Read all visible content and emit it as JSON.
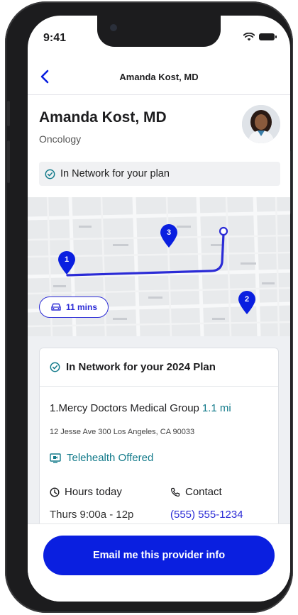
{
  "status_bar": {
    "time": "9:41"
  },
  "nav": {
    "title": "Amanda Kost, MD"
  },
  "provider": {
    "name": "Amanda Kost, MD",
    "specialty": "Oncology"
  },
  "network_badge": {
    "label": "In Network for your plan"
  },
  "map": {
    "pins": [
      "1",
      "2",
      "3"
    ],
    "drive_time": "11 mins"
  },
  "card": {
    "header": "In Network for your 2024 Plan",
    "group_name": "1.Mercy Doctors Medical Group",
    "distance": "1.1 mi",
    "address": "12 Jesse Ave 300 Los Angeles, CA 90033",
    "telehealth": "Telehealth Offered",
    "hours_label": "Hours today",
    "hours_value": "Thurs 9:00a - 12p",
    "contact_label": "Contact",
    "contact_value": "(555) 555-1234"
  },
  "cta": {
    "label": "Email me this provider info"
  },
  "colors": {
    "accent": "#0a1fe0",
    "route": "#2b2bd6",
    "teal": "#127a8a"
  }
}
